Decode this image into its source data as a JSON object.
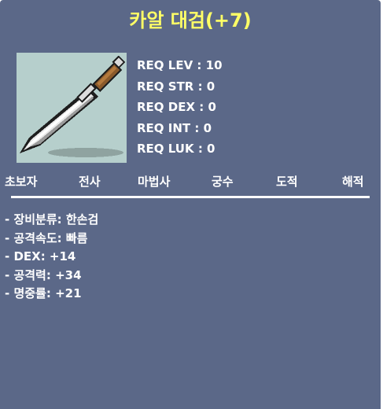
{
  "item": {
    "name": "카알 대검(+7)",
    "icon": "dagger-icon"
  },
  "requirements": [
    "REQ LEV : 10",
    "REQ STR : 0",
    "REQ DEX : 0",
    "REQ INT : 0",
    "REQ LUK : 0"
  ],
  "jobs": [
    "초보자",
    "전사",
    "마법사",
    "궁수",
    "도적",
    "해적"
  ],
  "stats": [
    "- 장비분류: 한손검",
    "- 공격속도: 빠름",
    "- DEX: +14",
    "- 공격력: +34",
    "- 명중률: +21"
  ],
  "colors": {
    "background": "#5b6888",
    "title": "#ffff66",
    "text": "#ffffff",
    "icon_frame": "#b6cfcc"
  }
}
